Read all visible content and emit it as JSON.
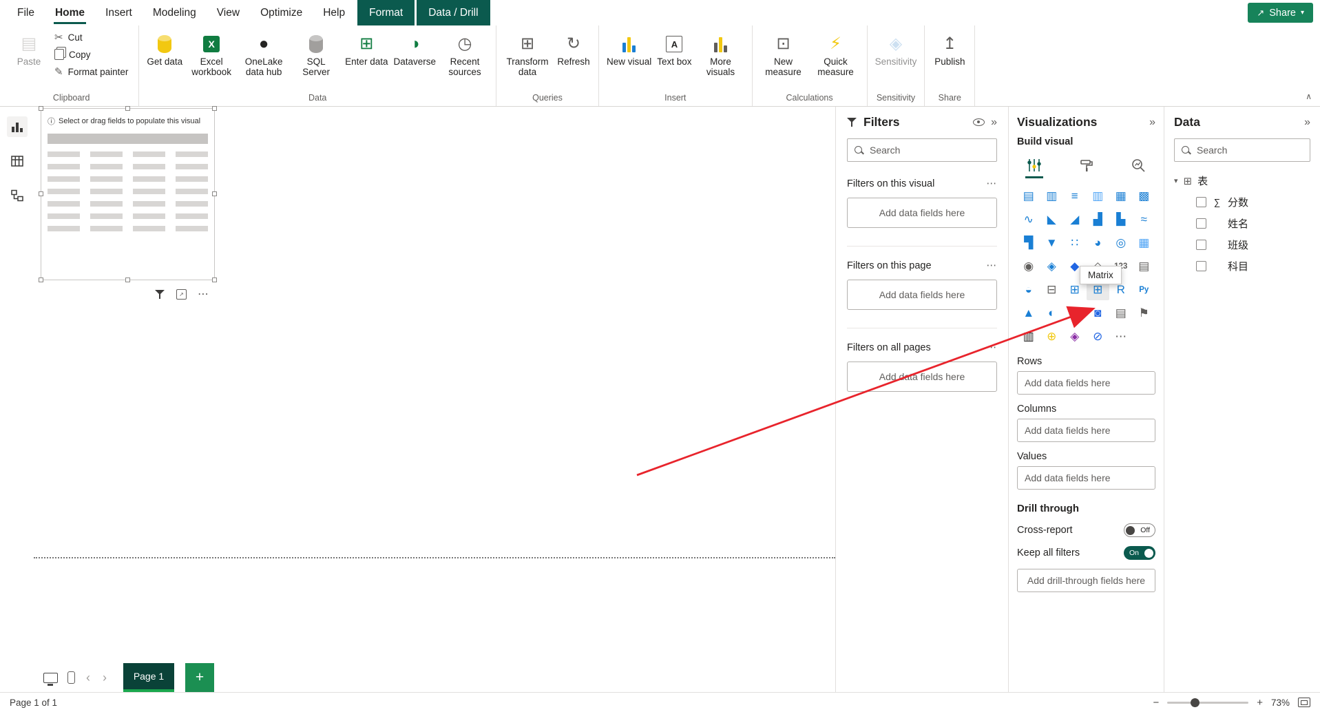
{
  "colors": {
    "accent_dark": "#0b5a4e",
    "accent_green": "#17835a",
    "tab_dark": "#0a4238",
    "underline_green": "#1aa74e",
    "plus_green": "#1b8f52",
    "icon_blue": "#1a7fd4",
    "yellow": "#f2c811",
    "arrow_red": "#e8242c",
    "text_primary": "#252423",
    "text_secondary": "#605e5c",
    "border_light": "#e1dfdd"
  },
  "icons": {
    "chevron_down": "▾",
    "chevron_up": "∧",
    "chevron_left": "‹",
    "chevron_right": "›",
    "double_chevron_right": "»",
    "more_options": "⋯",
    "minus": "−",
    "plus": "+",
    "sigma": "∑",
    "share_arrow": "↗",
    "info": "ⓘ",
    "table_grid": "⊞"
  },
  "titlebar": {
    "tabs": [
      {
        "label": "File",
        "state": "normal"
      },
      {
        "label": "Home",
        "state": "active"
      },
      {
        "label": "Insert",
        "state": "normal"
      },
      {
        "label": "Modeling",
        "state": "normal"
      },
      {
        "label": "View",
        "state": "normal"
      },
      {
        "label": "Optimize",
        "state": "normal"
      },
      {
        "label": "Help",
        "state": "normal"
      },
      {
        "label": "Format",
        "state": "contextual"
      },
      {
        "label": "Data / Drill",
        "state": "contextual"
      }
    ],
    "share_label": "Share"
  },
  "ribbon": {
    "groups": [
      {
        "label": "Clipboard",
        "buttons": [
          {
            "name": "paste",
            "label": "Paste",
            "size": "large",
            "disabled": true,
            "icon": {
              "type": "glyph",
              "glyph": "▤",
              "color": "#b3b0ad"
            }
          },
          {
            "name": "cut",
            "label": "Cut",
            "size": "small",
            "icon": {
              "type": "glyph",
              "glyph": "✂",
              "color": "#605e5c"
            }
          },
          {
            "name": "copy",
            "label": "Copy",
            "size": "small",
            "icon": {
              "type": "css",
              "cls": "copy-icon"
            }
          },
          {
            "name": "format-painter",
            "label": "Format painter",
            "size": "small",
            "icon": {
              "type": "glyph",
              "glyph": "✎",
              "color": "#605e5c"
            }
          }
        ]
      },
      {
        "label": "Data",
        "buttons": [
          {
            "name": "get-data",
            "label": "Get data",
            "size": "large",
            "chevron": true,
            "icon": {
              "type": "cyl",
              "color": "#f2c811"
            }
          },
          {
            "name": "excel-workbook",
            "label": "Excel workbook",
            "size": "large",
            "icon": {
              "type": "box",
              "bg": "#107c41",
              "text": "X"
            }
          },
          {
            "name": "onelake-data-hub",
            "label": "OneLake data hub",
            "size": "large",
            "chevron": true,
            "icon": {
              "type": "glyph",
              "glyph": "●",
              "color": "#252423"
            }
          },
          {
            "name": "sql-server",
            "label": "SQL Server",
            "size": "large",
            "icon": {
              "type": "cyl",
              "color": "#a19f9d"
            }
          },
          {
            "name": "enter-data",
            "label": "Enter data",
            "size": "large",
            "icon": {
              "type": "glyph",
              "glyph": "⊞",
              "color": "#107c41"
            }
          },
          {
            "name": "dataverse",
            "label": "Dataverse",
            "size": "large",
            "icon": {
              "type": "glyph",
              "glyph": "◑",
              "color": "#107c41"
            }
          },
          {
            "name": "recent-sources",
            "label": "Recent sources",
            "size": "large",
            "chevron": true,
            "icon": {
              "type": "glyph",
              "glyph": "◷",
              "color": "#605e5c"
            }
          }
        ]
      },
      {
        "label": "Queries",
        "buttons": [
          {
            "name": "transform-data",
            "label": "Transform data",
            "size": "large",
            "chevron": true,
            "icon": {
              "type": "glyph",
              "glyph": "⊞",
              "color": "#605e5c"
            }
          },
          {
            "name": "refresh",
            "label": "Refresh",
            "size": "large",
            "icon": {
              "type": "glyph",
              "glyph": "↻",
              "color": "#605e5c"
            }
          }
        ]
      },
      {
        "label": "Insert",
        "buttons": [
          {
            "name": "new-visual",
            "label": "New visual",
            "size": "large",
            "icon": {
              "type": "bars",
              "colors": [
                "#1a7fd4",
                "#f2c811",
                "#1a7fd4"
              ]
            }
          },
          {
            "name": "text-box",
            "label": "Text box",
            "size": "large",
            "icon": {
              "type": "boxo",
              "text": "A"
            }
          },
          {
            "name": "more-visuals",
            "label": "More visuals",
            "size": "large",
            "chevron": true,
            "icon": {
              "type": "bars",
              "colors": [
                "#605e5c",
                "#f2c811",
                "#605e5c"
              ]
            }
          }
        ]
      },
      {
        "label": "Calculations",
        "buttons": [
          {
            "name": "new-measure",
            "label": "New measure",
            "size": "large",
            "icon": {
              "type": "glyph",
              "glyph": "⊡",
              "color": "#605e5c"
            }
          },
          {
            "name": "quick-measure",
            "label": "Quick measure",
            "size": "large",
            "icon": {
              "type": "glyph",
              "glyph": "⚡",
              "color": "#f2c811"
            }
          }
        ]
      },
      {
        "label": "Sensitivity",
        "buttons": [
          {
            "name": "sensitivity",
            "label": "Sensitivity",
            "size": "large",
            "disabled": true,
            "chevron": true,
            "icon": {
              "type": "glyph",
              "glyph": "◈",
              "color": "#9cc3e5"
            }
          }
        ]
      },
      {
        "label": "Share",
        "buttons": [
          {
            "name": "publish",
            "label": "Publish",
            "size": "large",
            "icon": {
              "type": "glyph",
              "glyph": "↥",
              "color": "#605e5c"
            }
          }
        ]
      }
    ]
  },
  "canvas": {
    "placeholder_text": "Select or drag fields to populate this visual"
  },
  "filters": {
    "title": "Filters",
    "search_placeholder": "Search",
    "sections": [
      {
        "title": "Filters on this visual",
        "placeholder": "Add data fields here"
      },
      {
        "title": "Filters on this page",
        "placeholder": "Add data fields here"
      },
      {
        "title": "Filters on all pages",
        "placeholder": "Add data fields here"
      }
    ]
  },
  "viz": {
    "title": "Visualizations",
    "build_visual_label": "Build visual",
    "tooltip": "Matrix",
    "visuals": [
      {
        "name": "stacked-bar-chart",
        "glyph": "▤",
        "color": "#1a7fd4"
      },
      {
        "name": "stacked-column-chart",
        "glyph": "▥",
        "color": "#1a7fd4"
      },
      {
        "name": "clustered-bar-chart",
        "glyph": "≡",
        "color": "#1a7fd4"
      },
      {
        "name": "clustered-column-chart",
        "glyph": "▥",
        "color": "#4da3f5"
      },
      {
        "name": "100-stacked-bar-chart",
        "glyph": "▦",
        "color": "#1a7fd4"
      },
      {
        "name": "100-stacked-column-chart",
        "glyph": "▩",
        "color": "#1a7fd4"
      },
      {
        "name": "line-chart",
        "glyph": "∿",
        "color": "#1a7fd4"
      },
      {
        "name": "area-chart",
        "glyph": "◣",
        "color": "#1a7fd4"
      },
      {
        "name": "stacked-area-chart",
        "glyph": "◢",
        "color": "#1a7fd4"
      },
      {
        "name": "line-and-stacked-column-chart",
        "glyph": "▟",
        "color": "#1a7fd4"
      },
      {
        "name": "line-and-clustered-column-chart",
        "glyph": "▙",
        "color": "#1a7fd4"
      },
      {
        "name": "ribbon-chart",
        "glyph": "≈",
        "color": "#1a7fd4"
      },
      {
        "name": "waterfall-chart",
        "glyph": "▜",
        "color": "#1a7fd4"
      },
      {
        "name": "funnel-chart",
        "glyph": "▼",
        "color": "#1a7fd4"
      },
      {
        "name": "scatter-chart",
        "glyph": "∷",
        "color": "#1a7fd4"
      },
      {
        "name": "pie-chart",
        "glyph": "◕",
        "color": "#1a7fd4"
      },
      {
        "name": "donut-chart",
        "glyph": "◎",
        "color": "#1a7fd4"
      },
      {
        "name": "treemap",
        "glyph": "▦",
        "color": "#4da3f5"
      },
      {
        "name": "map",
        "glyph": "◉",
        "color": "#605e5c"
      },
      {
        "name": "filled-map",
        "glyph": "◈",
        "color": "#1a7fd4"
      },
      {
        "name": "azure-map",
        "glyph": "◆",
        "color": "#2266e3"
      },
      {
        "name": "shape-map",
        "glyph": "◇",
        "color": "#605e5c"
      },
      {
        "name": "card",
        "glyph": "123",
        "color": "#605e5c"
      },
      {
        "name": "multi-row-card",
        "glyph": "▤",
        "color": "#605e5c"
      },
      {
        "name": "gauge",
        "glyph": "◒",
        "color": "#1a7fd4"
      },
      {
        "name": "slicer",
        "glyph": "⊟",
        "color": "#605e5c"
      },
      {
        "name": "table",
        "glyph": "⊞",
        "color": "#1a7fd4"
      },
      {
        "name": "matrix",
        "glyph": "⊞",
        "color": "#1a7fd4",
        "active": true
      },
      {
        "name": "r-script-visual",
        "glyph": "R",
        "color": "#1a7fd4"
      },
      {
        "name": "python-visual",
        "glyph": "Py",
        "color": "#1a7fd4"
      },
      {
        "name": "kpi",
        "glyph": "▲",
        "color": "#1a7fd4"
      },
      {
        "name": "key-influencers",
        "glyph": "◐",
        "color": "#1a7fd4"
      },
      {
        "name": "decomposition-tree",
        "glyph": "∴",
        "color": "#f2c811"
      },
      {
        "name": "q-and-a",
        "glyph": "◙",
        "color": "#2266e3"
      },
      {
        "name": "smart-narrative",
        "glyph": "▤",
        "color": "#605e5c"
      },
      {
        "name": "metrics",
        "glyph": "⚑",
        "color": "#605e5c"
      },
      {
        "name": "paginated-report",
        "glyph": "▥",
        "color": "#252423"
      },
      {
        "name": "arcgis-map",
        "glyph": "⊕",
        "color": "#f2c811"
      },
      {
        "name": "power-apps",
        "glyph": "◈",
        "color": "#8a2da5"
      },
      {
        "name": "power-automate",
        "glyph": "⊘",
        "color": "#2266e3"
      },
      {
        "name": "get-more-visuals",
        "glyph": "⋯",
        "color": "#605e5c"
      }
    ],
    "wells": [
      {
        "label": "Rows",
        "placeholder": "Add data fields here"
      },
      {
        "label": "Columns",
        "placeholder": "Add data fields here"
      },
      {
        "label": "Values",
        "placeholder": "Add data fields here"
      }
    ],
    "drill_through": {
      "title": "Drill through",
      "toggles": [
        {
          "label": "Cross-report",
          "state": "off",
          "state_label": "Off"
        },
        {
          "label": "Keep all filters",
          "state": "on",
          "state_label": "On"
        }
      ],
      "well_placeholder": "Add drill-through fields here"
    }
  },
  "data_pane": {
    "title": "Data",
    "search_placeholder": "Search",
    "table": {
      "name": "表"
    },
    "fields": [
      {
        "label": "分数",
        "aggregate": true
      },
      {
        "label": "姓名"
      },
      {
        "label": "班级"
      },
      {
        "label": "科目"
      }
    ]
  },
  "pages": {
    "current_tab": "Page 1",
    "status": "Page 1 of 1"
  },
  "zoom": {
    "level": "73%"
  }
}
